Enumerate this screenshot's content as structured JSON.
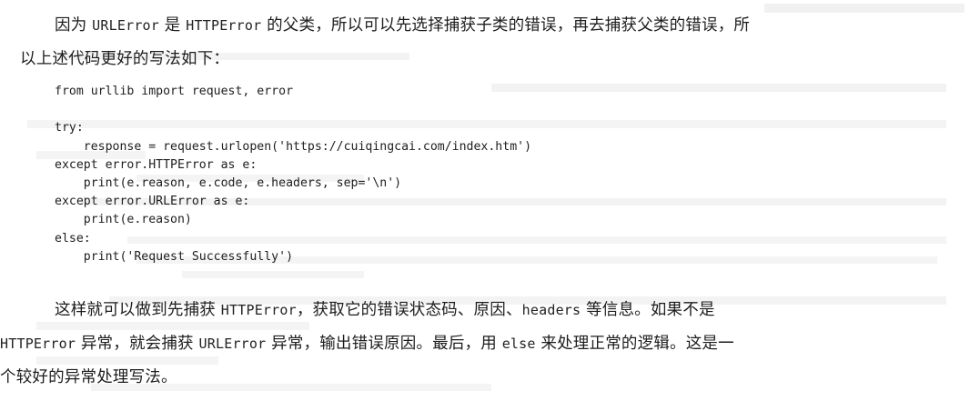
{
  "paragraph_1": {
    "line_1": [
      {
        "text": "因为 ",
        "mono": false
      },
      {
        "text": "URLError",
        "mono": true
      },
      {
        "text": " 是 ",
        "mono": false
      },
      {
        "text": "HTTPError",
        "mono": true
      },
      {
        "text": " 的父类，所以可以先选择捕获子类的错误，再去捕获父类的错误，所",
        "mono": false
      }
    ],
    "line_2": "以上述代码更好的写法如下："
  },
  "code": {
    "lines": [
      "from urllib import request, error",
      "",
      "try:",
      "    response = request.urlopen('https://cuiqingcai.com/index.htm')",
      "except error.HTTPError as e:",
      "    print(e.reason, e.code, e.headers, sep='\\n')",
      "except error.URLError as e:",
      "    print(e.reason)",
      "else:",
      "    print('Request Successfully')"
    ]
  },
  "paragraph_2": {
    "line_1": [
      {
        "text": "这样就可以做到先捕获 ",
        "mono": false
      },
      {
        "text": "HTTPError",
        "mono": true
      },
      {
        "text": "，获取它的错误状态码、原因、",
        "mono": false
      },
      {
        "text": "headers",
        "mono": true
      },
      {
        "text": " 等信息。如果不是",
        "mono": false
      }
    ],
    "line_2": [
      {
        "text": "HTTPError",
        "mono": true
      },
      {
        "text": " 异常，就会捕获 ",
        "mono": false
      },
      {
        "text": "URLError",
        "mono": true
      },
      {
        "text": " 异常，输出错误原因。最后，用 ",
        "mono": false
      },
      {
        "text": "else",
        "mono": true
      },
      {
        "text": " 来处理正常的逻辑。这是一",
        "mono": false
      }
    ],
    "line_3": "个较好的异常处理写法。"
  },
  "colors": {
    "text": "#1d1d1d",
    "background": "#ffffff",
    "bleed_through": "#e9e9e9"
  }
}
